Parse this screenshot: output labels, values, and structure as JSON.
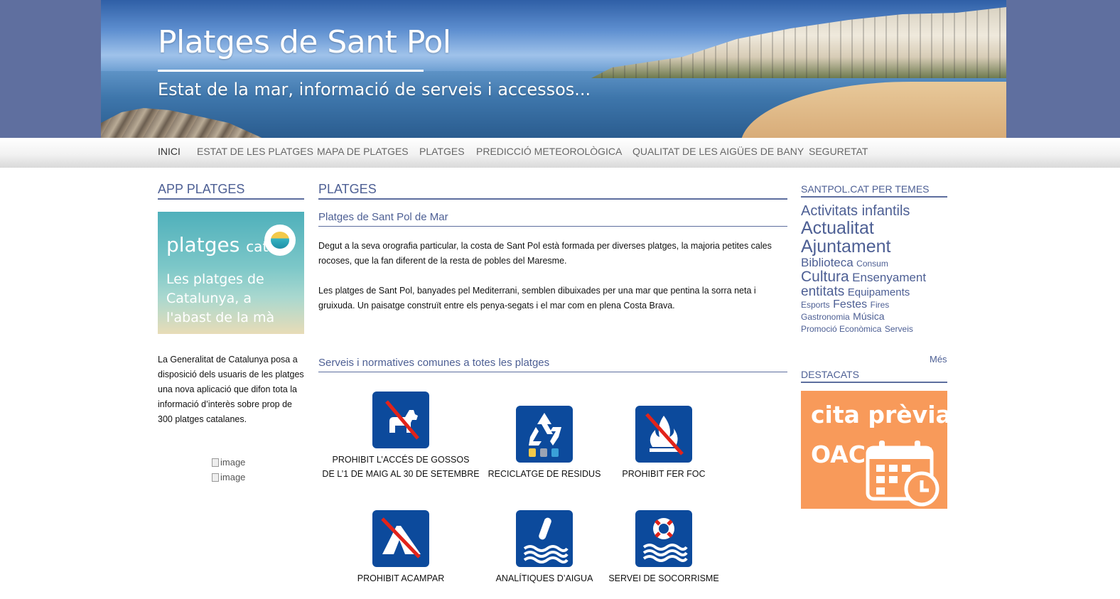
{
  "header": {
    "title": "Platges de Sant Pol",
    "subtitle": "Estat de la mar, informació de serveis i accessos..."
  },
  "nav": {
    "items": [
      {
        "label": "INICI",
        "active": true
      },
      {
        "label": "ESTAT DE LES PLATGES"
      },
      {
        "label": "MAPA DE PLATGES"
      },
      {
        "label": "PLATGES"
      },
      {
        "label": "PREDICCIÓ METEOROLÒGICA"
      },
      {
        "label": "QUALITAT DE LES AIGÜES DE BANY"
      },
      {
        "label": "SEGURETAT"
      }
    ]
  },
  "left": {
    "heading": "APP PLATGES",
    "app_banner": {
      "brand": "platges",
      "brand_suffix": "cat",
      "tagline": "Les platges de Catalunya, a l'abast de la mà"
    },
    "description": "La Generalitat de Catalunya posa a disposició dels usuaris de les platges una nova aplicació que difon tota la informació d’interès sobre prop de 300 platges catalanes.",
    "images": [
      {
        "alt": "image"
      },
      {
        "alt": "image"
      }
    ]
  },
  "main": {
    "heading": "PLATGES",
    "subheading": "Platges de Sant Pol de Mar",
    "paragraphs": [
      "Degut a la seva orografia particular, la costa de Sant Pol està formada per diverses platges, la majoria petites cales rocoses, que la fan diferent de la resta de pobles del Maresme.",
      "Les platges de Sant Pol, banyades pel Mediterrani, semblen dibuixades per una mar que pentina la sorra neta i gruixuda. Un paisatge construït entre els penya-segats i el mar com en plena Costa Brava."
    ],
    "services_heading": "Serveis i normatives comunes a totes les platges",
    "services": [
      {
        "line1": "PROHIBIT L’ACCÉS DE GOSSOS",
        "line2": "DE L’1 DE MAIG AL 30 DE SETEMBRE",
        "icon": "no-dogs-icon"
      },
      {
        "line1": "RECICLATGE DE RESIDUS",
        "icon": "recycling-icon"
      },
      {
        "line1": "PROHIBIT FER FOC",
        "icon": "no-fire-icon"
      },
      {
        "line1": "PROHIBIT ACAMPAR",
        "icon": "no-camping-icon"
      },
      {
        "line1": "ANALÍTIQUES D’AIGUA",
        "icon": "water-analysis-icon"
      },
      {
        "line1": "SERVEI DE SOCORRISME",
        "icon": "lifeguard-icon"
      }
    ],
    "icon_color": "#0c4a9c",
    "prohibit_color": "#e2231a"
  },
  "right": {
    "heading": "SANTPOL.CAT PER TEMES",
    "tags": [
      {
        "label": "Activitats infantils",
        "size": 20
      },
      {
        "label": "Actualitat",
        "size": 25
      },
      {
        "label": "Ajuntament",
        "size": 25
      },
      {
        "label": "Biblioteca",
        "size": 17
      },
      {
        "label": "Consum",
        "size": 12
      },
      {
        "label": "Cultura",
        "size": 21
      },
      {
        "label": "Ensenyament",
        "size": 17
      },
      {
        "label": "entitats",
        "size": 19
      },
      {
        "label": "Equipaments",
        "size": 15
      },
      {
        "label": "Esports",
        "size": 12
      },
      {
        "label": "Festes",
        "size": 16
      },
      {
        "label": "Fires",
        "size": 12
      },
      {
        "label": "Gastronomia",
        "size": 12
      },
      {
        "label": "Música",
        "size": 14
      },
      {
        "label": "Promoció Econòmica",
        "size": 12
      },
      {
        "label": "Serveis",
        "size": 12
      }
    ],
    "more": "Més",
    "featured_heading": "DESTACATS",
    "featured": {
      "line1": "cita prèvia",
      "line2": "OAC"
    },
    "accent": "#f89a5a"
  }
}
